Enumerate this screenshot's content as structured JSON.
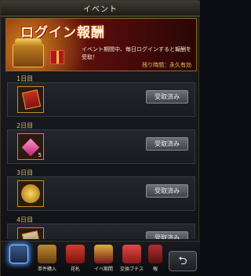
{
  "window": {
    "title": "イベント"
  },
  "banner": {
    "title": "ログイン報酬",
    "description": "イベント期間中、毎日ログインすると報酬を受取！",
    "period": "残り時間：永久有効"
  },
  "days": [
    {
      "label": "1日目",
      "item_icon": "red-card-icon",
      "count": "",
      "button": "受取済み"
    },
    {
      "label": "2日目",
      "item_icon": "pink-gem-icon",
      "count": "5",
      "button": "受取済み"
    },
    {
      "label": "3日目",
      "item_icon": "gold-coin-icon",
      "count": "",
      "button": "受取済み"
    },
    {
      "label": "4日目",
      "item_icon": "card-icon",
      "count": "",
      "button": "受取済み"
    }
  ],
  "tabs": [
    {
      "label": "",
      "icon": "login-reward-icon",
      "active": true
    },
    {
      "label": "単件購入",
      "icon": "purchase-chest-icon",
      "active": false
    },
    {
      "label": "花札",
      "icon": "hanafuda-icon",
      "active": false
    },
    {
      "label": "イベ期間",
      "icon": "event-gift-icon",
      "active": false
    },
    {
      "label": "交換ブチス",
      "icon": "exchange-gift-icon",
      "active": false
    },
    {
      "label": "報",
      "icon": "report-icon",
      "active": false
    }
  ],
  "back_button": {
    "icon": "back-arrow-icon",
    "glyph": "⮌"
  }
}
